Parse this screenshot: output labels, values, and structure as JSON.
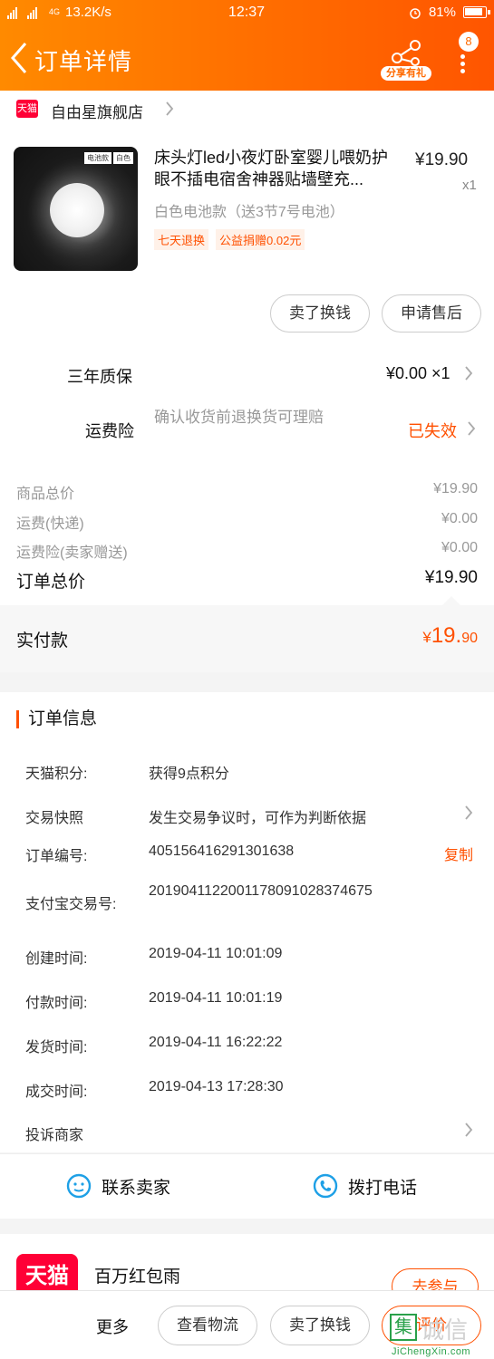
{
  "status_bar": {
    "network": "4G",
    "speed": "13.2K/s",
    "time": "12:37",
    "battery": "81%"
  },
  "header": {
    "title": "订单详情",
    "share_label": "分享有礼",
    "badge_count": "8",
    "bg_color": "#ff7a00"
  },
  "shop": {
    "platform_badge": "天猫",
    "name": "自由星旗舰店"
  },
  "product": {
    "title": "床头灯led小夜灯卧室婴儿喂奶护眼不插电宿舍神器贴墙壁充...",
    "price": "¥19.90",
    "qty": "x1",
    "spec": "白色电池款（送3节7号电池）",
    "tags": [
      "七天退换",
      "公益捐赠0.02元"
    ],
    "thumb_tags": [
      "电池款",
      "白色"
    ]
  },
  "actions": {
    "sell_exchange": "卖了换钱",
    "after_sale": "申请售后"
  },
  "warranty": {
    "label": "三年质保",
    "value": "¥0.00 ×1"
  },
  "shipping_insurance": {
    "label": "运费险",
    "desc": "确认收货前退换货可理赔",
    "status": "已失效"
  },
  "summary": {
    "goods_total_label": "商品总价",
    "goods_total": "¥19.90",
    "shipping_label": "运费(快递)",
    "shipping": "¥0.00",
    "insurance_label": "运费险(卖家赠送)",
    "insurance": "¥0.00",
    "order_total_label": "订单总价",
    "order_total": "¥19.90",
    "paid_label": "实付款",
    "paid_currency": "¥",
    "paid_int": "19.",
    "paid_dec": "90"
  },
  "order_info": {
    "title": "订单信息",
    "rows": [
      {
        "label": "天猫积分:",
        "value": "获得9点积分"
      },
      {
        "label": "交易快照",
        "value": "发生交易争议时，可作为判断依据"
      },
      {
        "label": "订单编号:",
        "value": "405156416291301638"
      },
      {
        "label": "支付宝交易号:",
        "value": "2019041122001178091028374675"
      },
      {
        "label": "创建时间:",
        "value": "2019-04-11 10:01:09"
      },
      {
        "label": "付款时间:",
        "value": "2019-04-11 10:01:19"
      },
      {
        "label": "发货时间:",
        "value": "2019-04-11 16:22:22"
      },
      {
        "label": "成交时间:",
        "value": "2019-04-13 17:28:30"
      },
      {
        "label": "投诉商家",
        "value": ""
      }
    ],
    "copy_label": "复制"
  },
  "contact": {
    "seller": "联系卖家",
    "phone": "拨打电话"
  },
  "promo": {
    "logo": "天猫",
    "text": "百万红包雨",
    "button": "去参与"
  },
  "bottom_bar": {
    "more": "更多",
    "logistics": "查看物流",
    "sell": "卖了换钱",
    "review": "评价"
  },
  "watermark": {
    "char": "集",
    "text": "诚信",
    "url": "JiChengXin.com"
  }
}
